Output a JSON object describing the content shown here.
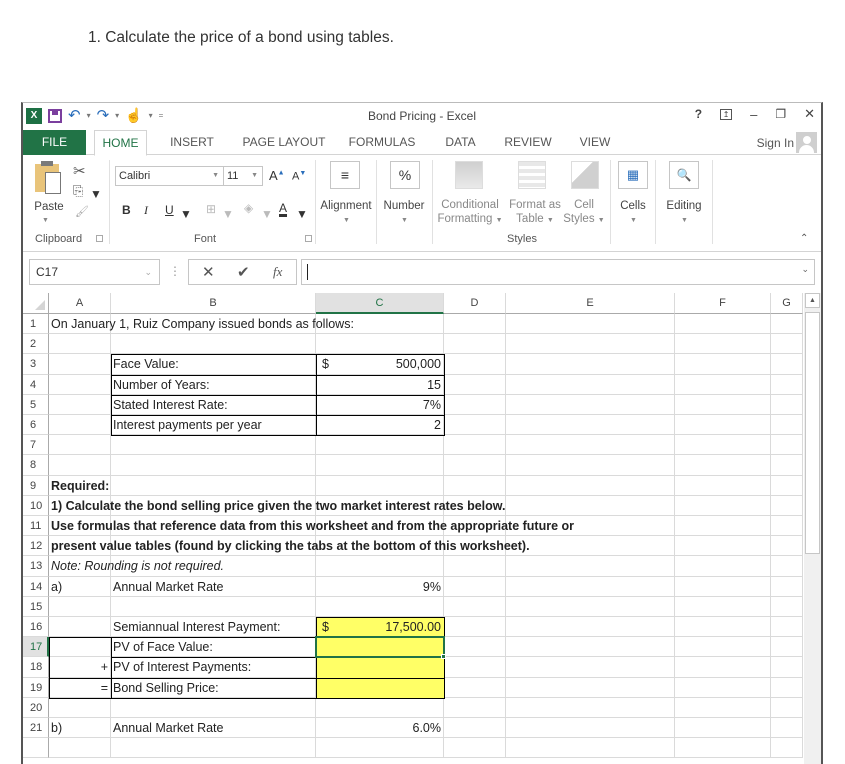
{
  "question": "1. Calculate the price of a bond using tables.",
  "window": {
    "title": "Bond Pricing - Excel",
    "controls": {
      "help": "?",
      "ribbon_options": "⤒",
      "minimize": "–",
      "restore": "🗗",
      "close": "✕"
    }
  },
  "quick_access": {
    "logo": "X",
    "undo": "↶",
    "redo": "↷",
    "more": "▾",
    "customize": "="
  },
  "tabs": [
    {
      "label": "FILE"
    },
    {
      "label": "HOME",
      "active": true
    },
    {
      "label": "INSERT"
    },
    {
      "label": "PAGE LAYOUT"
    },
    {
      "label": "FORMULAS"
    },
    {
      "label": "DATA"
    },
    {
      "label": "REVIEW"
    },
    {
      "label": "VIEW"
    }
  ],
  "account": {
    "sign_in": "Sign In"
  },
  "ribbon": {
    "clipboard": {
      "label": "Clipboard",
      "paste": "Paste"
    },
    "font": {
      "label": "Font",
      "font_name": "Calibri",
      "font_size": "11",
      "grow": "A",
      "shrink": "A",
      "bold": "B",
      "italic": "I",
      "underline": "U",
      "font_color": "A"
    },
    "alignment": {
      "label": "Alignment",
      "icon": "≡"
    },
    "number": {
      "label": "Number",
      "icon": "%"
    },
    "styles": {
      "label": "Styles",
      "conditional_formatting": [
        "Conditional",
        "Formatting"
      ],
      "format_as_table": [
        "Format as",
        "Table"
      ],
      "cell_styles": [
        "Cell",
        "Styles"
      ]
    },
    "cells": {
      "label": "Cells"
    },
    "editing": {
      "label": "Editing"
    }
  },
  "formula_bar": {
    "name_box": "C17",
    "cancel": "✕",
    "enter": "✔",
    "fx": "fx",
    "value": ""
  },
  "sheet": {
    "columns": [
      "A",
      "B",
      "C",
      "D",
      "E",
      "F",
      "G"
    ],
    "selected_column": "C",
    "rows": [
      "1",
      "2",
      "3",
      "4",
      "5",
      "6",
      "7",
      "8",
      "9",
      "10",
      "11",
      "12",
      "13",
      "14",
      "15",
      "16",
      "17",
      "18",
      "19",
      "20",
      "21"
    ],
    "selected_row": "17",
    "selected_cell": "C17",
    "cells": {
      "A1": "On January 1,  Ruiz Company issued bonds as follows:",
      "B3": "Face Value:",
      "C3_currency": "$",
      "C3": "500,000",
      "B4": "Number of Years:",
      "C4": "15",
      "B5": "Stated Interest Rate:",
      "C5": "7%",
      "B6": "Interest payments per year",
      "C6": "2",
      "A9": "Required:",
      "A10": "1) Calculate the bond selling price given the two market interest rates below.",
      "A11": "Use formulas that reference data from this worksheet and from the appropriate future or",
      "A12": "present value tables (found by clicking the tabs at the bottom of this worksheet).",
      "A13": "Note:  Rounding is not required.",
      "A14": "a)",
      "B14": "Annual Market Rate",
      "C14": "9%",
      "B16": "Semiannual Interest Payment:",
      "C16_currency": "$",
      "C16": "17,500.00",
      "B17": "PV of Face Value:",
      "C17": "",
      "A18": "+",
      "B18": "PV of Interest Payments:",
      "C18": "",
      "A19": "=",
      "B19": "Bond Selling Price:",
      "C19": "",
      "A21": "b)",
      "B21": "Annual Market Rate",
      "C21": "6.0%"
    }
  },
  "colors": {
    "excel_green": "#217346",
    "input_yellow": "#ffff66"
  }
}
